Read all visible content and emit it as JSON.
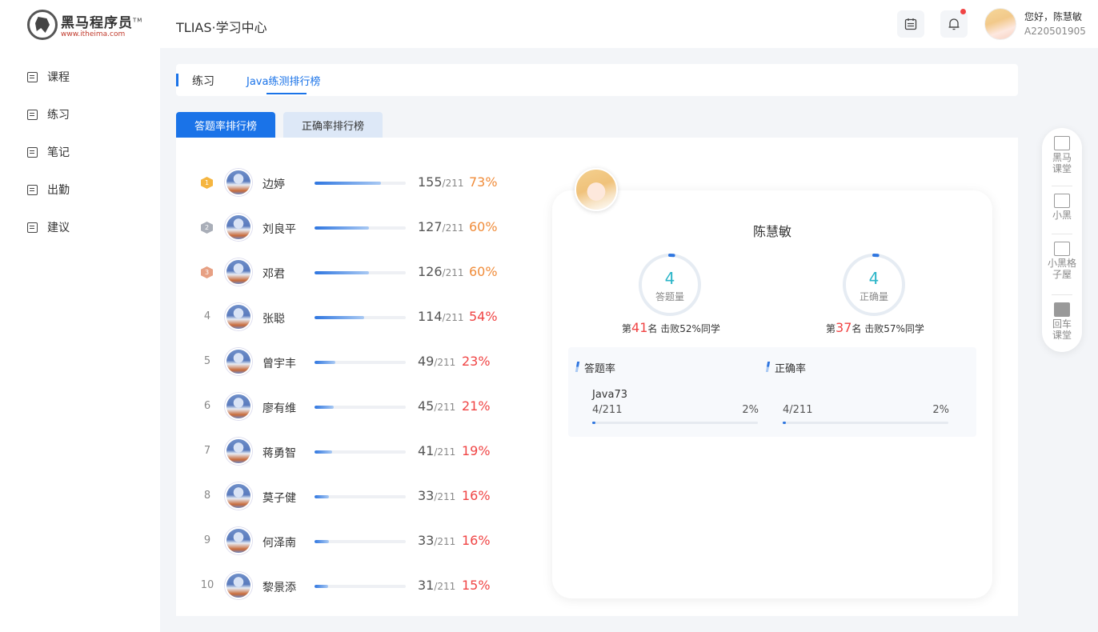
{
  "brand": {
    "name": "黑马程序员",
    "tm": "TM",
    "url": "www.itheima.com"
  },
  "nav": [
    {
      "label": "课程",
      "icon": "course-icon"
    },
    {
      "label": "练习",
      "icon": "practice-icon"
    },
    {
      "label": "笔记",
      "icon": "notes-icon"
    },
    {
      "label": "出勤",
      "icon": "attendance-icon"
    },
    {
      "label": "建议",
      "icon": "suggestion-icon"
    }
  ],
  "header": {
    "title": "TLIAS·学习中心",
    "greeting": "您好，陈慧敏",
    "user_id": "A220501905"
  },
  "tabs": {
    "practice": "练习",
    "leaderboard": "Java练测排行榜"
  },
  "toggles": {
    "answer_rate": "答题率排行榜",
    "correct_rate": "正确率排行榜"
  },
  "ranking": [
    {
      "rank": "1",
      "name": "边婷",
      "count": "155",
      "total": "/211",
      "percent": "73%",
      "fill": 0.73,
      "color": "#f08c3a"
    },
    {
      "rank": "2",
      "name": "刘良平",
      "count": "127",
      "total": "/211",
      "percent": "60%",
      "fill": 0.6,
      "color": "#f08c3a"
    },
    {
      "rank": "3",
      "name": "邓君",
      "count": "126",
      "total": "/211",
      "percent": "60%",
      "fill": 0.6,
      "color": "#f08c3a"
    },
    {
      "rank": "4",
      "name": "张聪",
      "count": "114",
      "total": "/211",
      "percent": "54%",
      "fill": 0.54,
      "color": "#f04444"
    },
    {
      "rank": "5",
      "name": "曾宇丰",
      "count": "49",
      "total": "/211",
      "percent": "23%",
      "fill": 0.23,
      "color": "#f04444"
    },
    {
      "rank": "6",
      "name": "廖有维",
      "count": "45",
      "total": "/211",
      "percent": "21%",
      "fill": 0.21,
      "color": "#f04444"
    },
    {
      "rank": "7",
      "name": "蒋勇智",
      "count": "41",
      "total": "/211",
      "percent": "19%",
      "fill": 0.19,
      "color": "#f04444"
    },
    {
      "rank": "8",
      "name": "莫子健",
      "count": "33",
      "total": "/211",
      "percent": "16%",
      "fill": 0.16,
      "color": "#f04444"
    },
    {
      "rank": "9",
      "name": "何泽南",
      "count": "33",
      "total": "/211",
      "percent": "16%",
      "fill": 0.16,
      "color": "#f04444"
    },
    {
      "rank": "10",
      "name": "黎景添",
      "count": "31",
      "total": "/211",
      "percent": "15%",
      "fill": 0.15,
      "color": "#f04444"
    }
  ],
  "profile": {
    "name": "陈慧敏",
    "answer": {
      "value": "4",
      "label": "答题量",
      "rank_prefix": "第",
      "rank": "41",
      "rank_suffix": "名  击败52%同学",
      "progress": 0.02
    },
    "correct": {
      "value": "4",
      "label": "正确量",
      "rank_prefix": "第",
      "rank": "37",
      "rank_suffix": "名  击败57%同学",
      "progress": 0.02
    }
  },
  "stats": {
    "answer_rate": {
      "title": "答题率",
      "course": "Java73",
      "fraction": "4/211",
      "percent": "2%",
      "fill": 0.02
    },
    "correct_rate": {
      "title": "正确率",
      "fraction": "4/211",
      "percent": "2%",
      "fill": 0.02
    }
  },
  "float_panel": [
    {
      "label": "黑马课堂",
      "icon": "classroom-icon"
    },
    {
      "label": "小黑",
      "icon": "grid-icon"
    },
    {
      "label": "小黑格子屋",
      "icon": "grid-house-icon"
    },
    {
      "label": "回车课堂",
      "icon": "enter-icon"
    }
  ],
  "colors": {
    "accent": "#1a73e8",
    "orange": "#f08c3a",
    "red": "#f04444",
    "teal": "#2bb5c8"
  }
}
